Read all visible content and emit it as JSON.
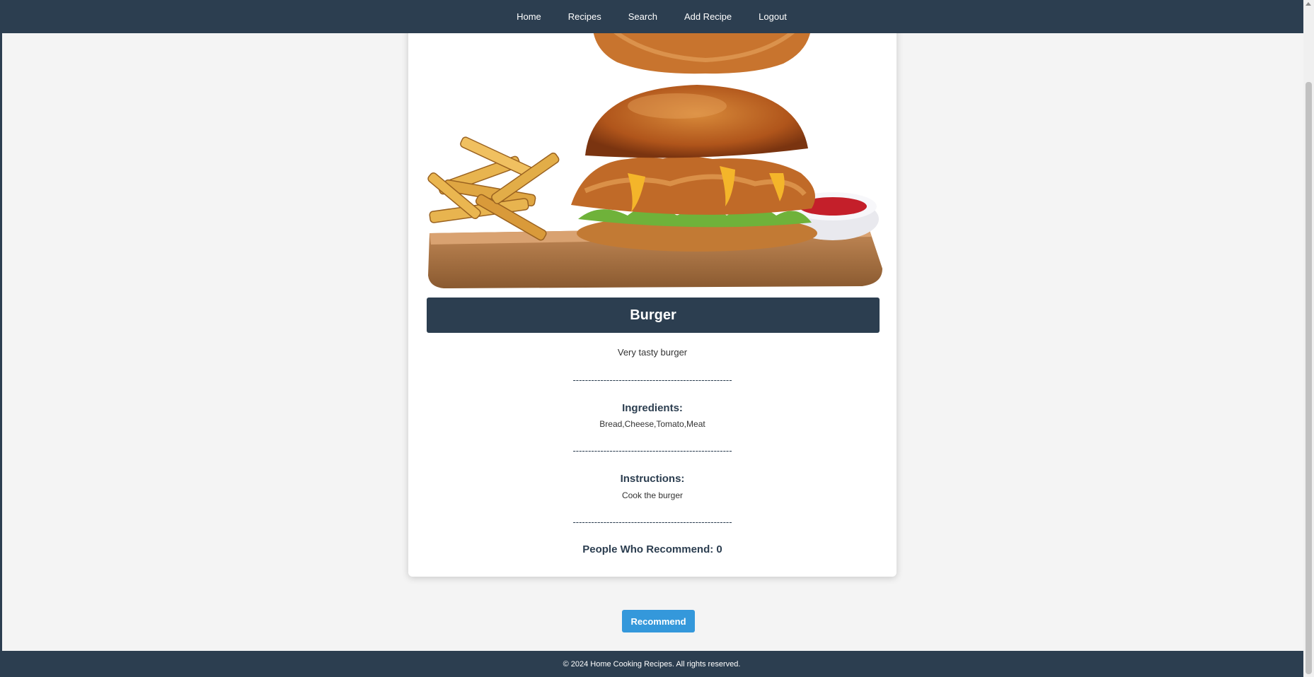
{
  "nav": {
    "items": [
      {
        "label": "Home"
      },
      {
        "label": "Recipes"
      },
      {
        "label": "Search"
      },
      {
        "label": "Add Recipe"
      },
      {
        "label": "Logout"
      }
    ]
  },
  "recipe": {
    "image_alt": "burger-photo",
    "title": "Burger",
    "description": "Very tasty burger",
    "separator": "----------------------------------------------------",
    "ingredients_heading": "Ingredients:",
    "ingredients": "Bread,Cheese,Tomato,Meat",
    "instructions_heading": "Instructions:",
    "instructions": "Cook the burger",
    "recommend_text": "People Who Recommend: 0"
  },
  "actions": {
    "recommend_label": "Recommend"
  },
  "footer": {
    "text": "© 2024 Home Cooking Recipes. All rights reserved."
  },
  "colors": {
    "navy": "#2c3e50",
    "accent": "#3498db",
    "background": "#f4f4f4"
  }
}
